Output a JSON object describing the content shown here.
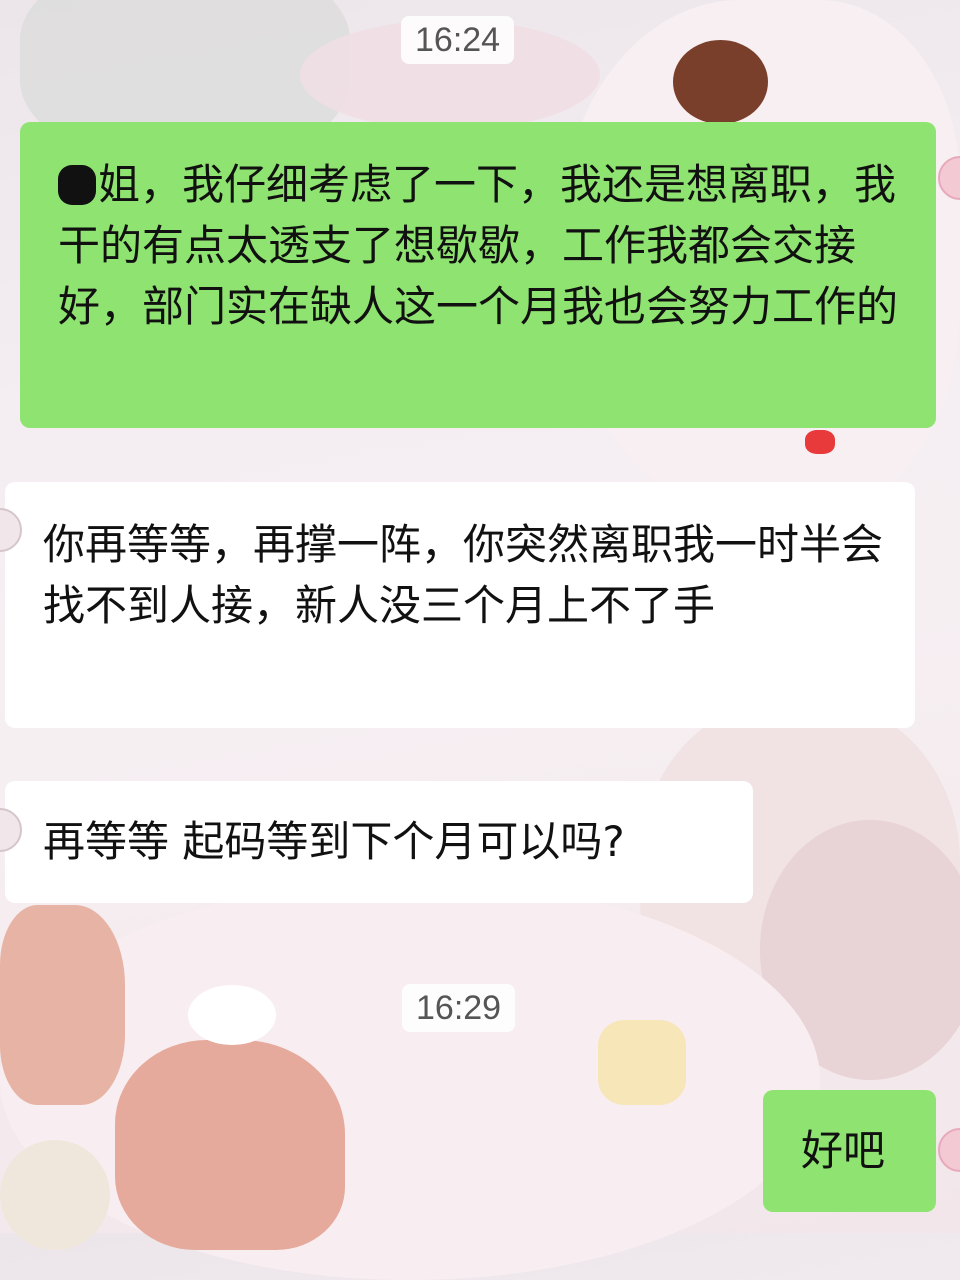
{
  "chat": {
    "timestamps": [
      "16:24",
      "16:29"
    ],
    "messages": [
      {
        "sender": "me",
        "text": "姐，我仔细考虑了一下，我还是想离职，我干的有点太透支了想歇歇，工作我都会交接好，部门实在缺人这一个月我也会努力工作的"
      },
      {
        "sender": "them",
        "text": "你再等等，再撑一阵，你突然离职我一时半会找不到人接，新人没三个月上不了手"
      },
      {
        "sender": "them",
        "text": "再等等 起码等到下个月可以吗?"
      },
      {
        "sender": "me",
        "text": "好吧"
      }
    ]
  },
  "colors": {
    "outgoing_bubble": "#8fe370",
    "incoming_bubble": "#ffffff",
    "timestamp_bg": "#ffffff"
  }
}
